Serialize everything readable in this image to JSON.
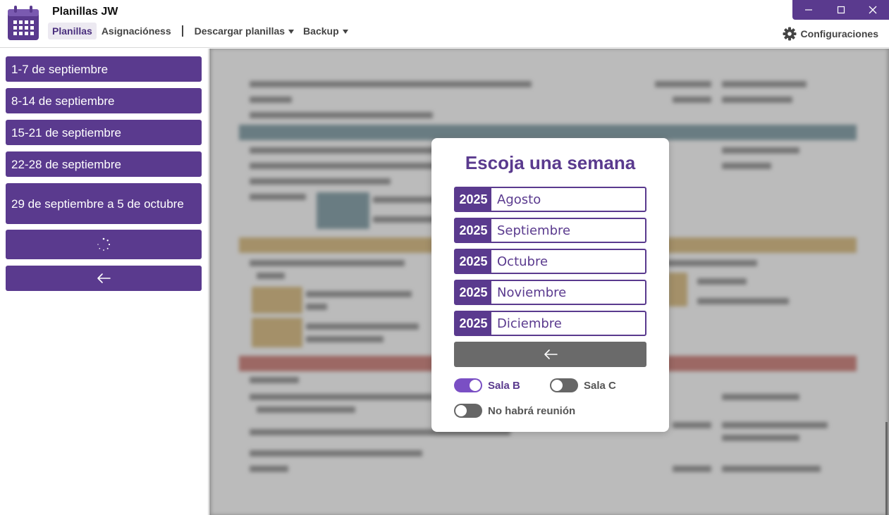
{
  "app": {
    "title": "Planillas JW"
  },
  "menu": {
    "planillas": "Planillas",
    "asignaciones": "Asignacióness",
    "descargar": "Descargar planillas",
    "backup": "Backup",
    "settings": "Configuraciones"
  },
  "sidebar": {
    "weeks": [
      "1-7 de septiembre",
      "8-14 de septiembre",
      "15-21 de septiembre",
      "22-28 de septiembre",
      "29 de septiembre a 5 de octubre"
    ]
  },
  "modal": {
    "title": "Escoja una semana",
    "months": [
      {
        "year": "2025",
        "name": "Agosto"
      },
      {
        "year": "2025",
        "name": "Septiembre"
      },
      {
        "year": "2025",
        "name": "Octubre"
      },
      {
        "year": "2025",
        "name": "Noviembre"
      },
      {
        "year": "2025",
        "name": "Diciembre"
      }
    ],
    "toggles": {
      "sala_b": {
        "label": "Sala B",
        "on": true
      },
      "sala_c": {
        "label": "Sala C",
        "on": false
      },
      "no_reunion": {
        "label": "No habrá reunión",
        "on": false
      }
    }
  },
  "colors": {
    "accent": "#5a3a8e",
    "band_teal": "#3e6b78",
    "band_gold": "#c89a3c",
    "band_red": "#b53a30"
  },
  "icons": {
    "app": "calendar-icon",
    "settings": "gear-icon",
    "back": "arrow-left-icon",
    "loading": "spinner-icon"
  }
}
